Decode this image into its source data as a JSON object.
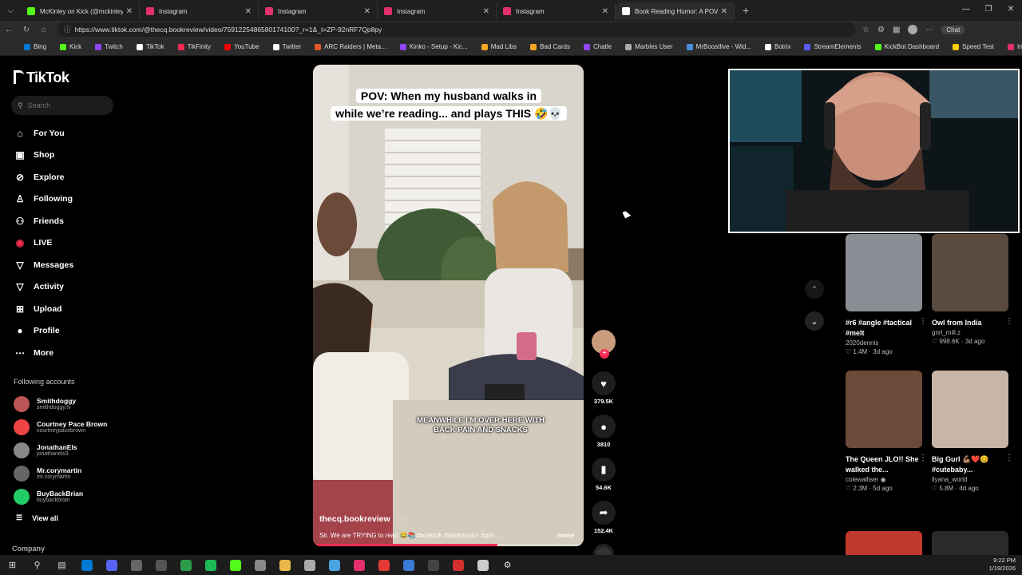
{
  "browser": {
    "tabs": [
      {
        "title": "McKinley on Kick (@mckinley.tv) |",
        "color": "#53fc18"
      },
      {
        "title": "Instagram",
        "color": "#e1306c"
      },
      {
        "title": "Instagram",
        "color": "#e1306c"
      },
      {
        "title": "Instagram",
        "color": "#e1306c"
      },
      {
        "title": "Instagram",
        "color": "#e1306c"
      },
      {
        "title": "Book Reading Humor: A POV",
        "color": "#ffffff"
      }
    ],
    "url": "https://www.tiktok.com/@thecq.bookreview/video/759122548658017410​0?_r=1&_t=ZP-92nRF7Qp8py",
    "copilot_label": "Chat",
    "bookmarks": [
      {
        "label": "Bing",
        "color": "#0078d4"
      },
      {
        "label": "Kick",
        "color": "#53fc18"
      },
      {
        "label": "Twitch",
        "color": "#9146ff"
      },
      {
        "label": "TikTok",
        "color": "#ffffff"
      },
      {
        "label": "TikFinity",
        "color": "#fe2c55"
      },
      {
        "label": "YouTube",
        "color": "#ff0000"
      },
      {
        "label": "Twitter",
        "color": "#ffffff"
      },
      {
        "label": "ARC Raiders | Meta...",
        "color": "#e4572e"
      },
      {
        "label": "Kinko - Setup - Kic...",
        "color": "#9146ff"
      },
      {
        "label": "Mad Libs",
        "color": "#f5a623"
      },
      {
        "label": "Bad Cards",
        "color": "#f5a623"
      },
      {
        "label": "Chatle",
        "color": "#9146ff"
      },
      {
        "label": "Marbles User",
        "color": "#aaaaaa"
      },
      {
        "label": "MrBoostlive - Wid...",
        "color": "#4a90e2"
      },
      {
        "label": "Botrix",
        "color": "#ffffff"
      },
      {
        "label": "StreamElements",
        "color": "#5b5bff"
      },
      {
        "label": "KickBot Dashboard",
        "color": "#53fc18"
      },
      {
        "label": "Speed Test",
        "color": "#ffd000"
      },
      {
        "label": "Inbox",
        "color": "#e1306c"
      }
    ]
  },
  "sidebar": {
    "logo": "TikTok",
    "search_placeholder": "Search",
    "nav": [
      {
        "label": "For You",
        "icon": "home-icon",
        "glyph": "⌂"
      },
      {
        "label": "Shop",
        "icon": "shop-icon",
        "glyph": "▣"
      },
      {
        "label": "Explore",
        "icon": "compass-icon",
        "glyph": "⊘"
      },
      {
        "label": "Following",
        "icon": "following-icon",
        "glyph": "♙"
      },
      {
        "label": "Friends",
        "icon": "friends-icon",
        "glyph": "⚇"
      },
      {
        "label": "LIVE",
        "icon": "live-icon",
        "glyph": "◉"
      },
      {
        "label": "Messages",
        "icon": "messages-icon",
        "glyph": "▽"
      },
      {
        "label": "Activity",
        "icon": "activity-icon",
        "glyph": "▽"
      },
      {
        "label": "Upload",
        "icon": "upload-icon",
        "glyph": "⊞"
      },
      {
        "label": "Profile",
        "icon": "profile-icon",
        "glyph": "●"
      },
      {
        "label": "More",
        "icon": "more-icon",
        "glyph": "⋯"
      }
    ],
    "following_title": "Following accounts",
    "following": [
      {
        "name": "Smithdoggy",
        "handle": "smithdoggy.tv",
        "color": "#b55"
      },
      {
        "name": "Courtney Pace Brown",
        "handle": "courtneypacebrown",
        "color": "#e44"
      },
      {
        "name": "JonathanEls",
        "handle": "jonathanels3",
        "color": "#888"
      },
      {
        "name": "Mr.corymartin",
        "handle": "mr.corymartin",
        "color": "#666"
      },
      {
        "name": "BuyBackBrian",
        "handle": "buybackbrian",
        "color": "#2c6"
      }
    ],
    "view_all": "View all",
    "company": "Company"
  },
  "video": {
    "caption_top_1": "POV: When my husband walks in",
    "caption_top_2": "while we’re reading... and plays THIS 🤣💀",
    "caption_bottom_1": "MEANWHILE I’M OVER HERE WITH",
    "caption_bottom_2": "BACK PAIN AND SNACKS",
    "author": "thecq.bookreview",
    "date": "· 1-3",
    "description": "Sir. We are TRYING to read 😂📚#booktok #bookhumor #pov ...",
    "more": "more",
    "progress": 0.68
  },
  "actions": {
    "likes": "379.5K",
    "comments": "3810",
    "saves": "54.6K",
    "shares": "152.4K"
  },
  "recommendations": [
    {
      "title": "#r6 #angle #tactical #melt",
      "author": "2020dennis",
      "stats": "♡ 1.4M · 3d ago",
      "color": "#8a8d94"
    },
    {
      "title": "Owl from India",
      "author": "gnrl_mill.z",
      "stats": "♡ 998.6K · 3d ago",
      "color": "#5a4a3e"
    },
    {
      "title": "The Queen JLO!! She walked the...",
      "author": "colewalliser ◉",
      "stats": "♡ 2.3M · 5d ago",
      "color": "#6b4a3a"
    },
    {
      "title": "Big Gurl 💪🏽❤️😊 #cutebaby...",
      "author": "llyana_world",
      "stats": "♡ 5.8M · 4d ago",
      "color": "#c7b6a8"
    }
  ],
  "taskbar": {
    "time": "9:22 PM",
    "date": "1/19/2026",
    "apps": [
      "#0078d4",
      "#5865f2",
      "#666666",
      "#555555",
      "#2c9c4a",
      "#1db954",
      "#53fc18",
      "#888888",
      "#e8b84a",
      "#aaaaaa",
      "#49a3e0",
      "#e1306c",
      "#e53935",
      "#3a7bd5",
      "#444444",
      "#d32f2f",
      "#cccccc"
    ]
  }
}
